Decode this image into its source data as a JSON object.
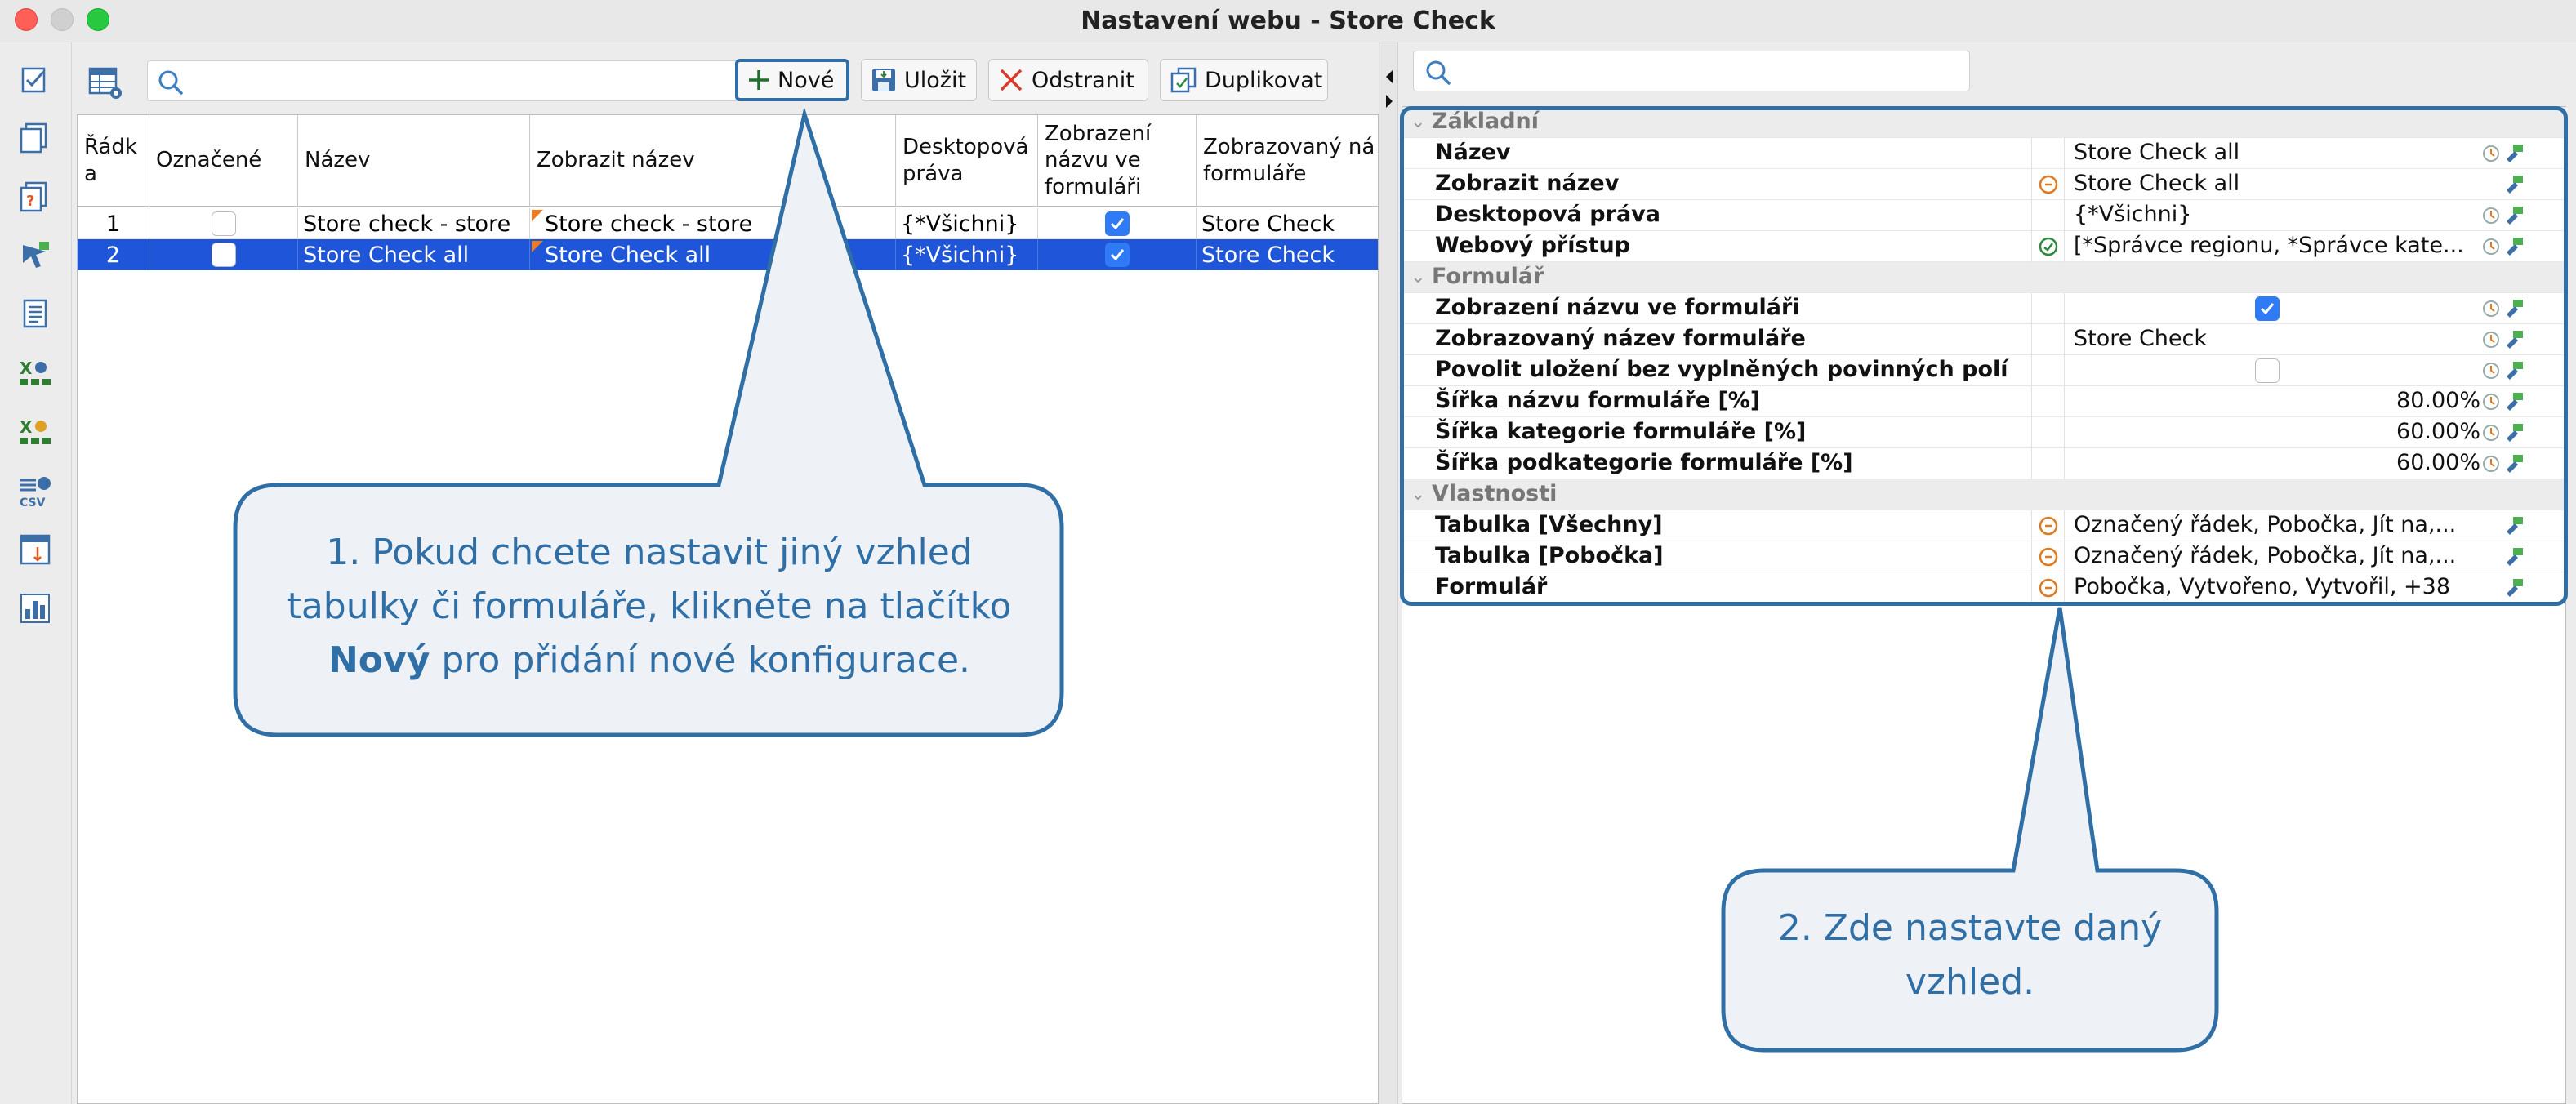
{
  "window": {
    "title": "Nastavení webu - Store Check"
  },
  "toolbar": {
    "search_placeholder": "",
    "new_label": "Nové",
    "save_label": "Uložit",
    "delete_label": "Odstranit",
    "duplicate_label": "Duplikovat"
  },
  "table": {
    "columns": [
      "Řádk a",
      "Označené",
      "Název",
      "Zobrazit název",
      "Desktopová práva",
      "Zobrazení názvu ve formuláři",
      "Zobrazovaný ná formuláře"
    ],
    "rows": [
      {
        "num": "1",
        "checked": false,
        "name": "Store check - store",
        "display_name": "Store check - store",
        "rights": "{*Všichni}",
        "show_in_form": true,
        "form_name": "Store Check"
      },
      {
        "num": "2",
        "checked": false,
        "name": "Store Check all",
        "display_name": "Store Check all",
        "rights": "{*Všichni}",
        "show_in_form": true,
        "form_name": "Store Check"
      }
    ]
  },
  "properties": {
    "search_placeholder": "",
    "sections": [
      {
        "title": "Základní"
      },
      {
        "title": "Formulář"
      },
      {
        "title": "Vlastnosti"
      }
    ],
    "basic": [
      {
        "label": "Název",
        "value": "Store Check all"
      },
      {
        "label": "Zobrazit název",
        "value": "Store Check all"
      },
      {
        "label": "Desktopová práva",
        "value": "{*Všichni}"
      },
      {
        "label": "Webový přístup",
        "value": "[*Správce regionu, *Správce kate..."
      }
    ],
    "form": [
      {
        "label": "Zobrazení názvu ve formuláři",
        "checked": true
      },
      {
        "label": "Zobrazovaný název formuláře",
        "value": "Store Check"
      },
      {
        "label": "Povolit uložení bez vyplněných povinných polí",
        "checked": false
      },
      {
        "label": "Šířka názvu formuláře [%]",
        "value": "80.00%"
      },
      {
        "label": "Šířka kategorie formuláře [%]",
        "value": "60.00%"
      },
      {
        "label": "Šířka podkategorie formuláře [%]",
        "value": "60.00%"
      }
    ],
    "props": [
      {
        "label": "Tabulka [Všechny]",
        "value": "Označený řádek, Pobočka, Jít na,..."
      },
      {
        "label": "Tabulka [Pobočka]",
        "value": "Označený řádek, Pobočka, Jít na,..."
      },
      {
        "label": "Formulář",
        "value": "Pobočka, Vytvořeno, Vytvořil, +38"
      }
    ]
  },
  "callouts": {
    "one_line1": "1. Pokud chcete nastavit jiný vzhled",
    "one_line2": "tabulky či formuláře, klikněte na tlačítko",
    "one_bold": "Nový",
    "one_rest": " pro přidání nové konfigurace.",
    "two_line1": "2. Zde nastavte daný",
    "two_line2": "vzhled."
  },
  "colors": {
    "accent": "#2f6fa6",
    "selection": "#1f55d8",
    "checkbox": "#2f7bf5",
    "callout_fill": "#eef2f7"
  }
}
